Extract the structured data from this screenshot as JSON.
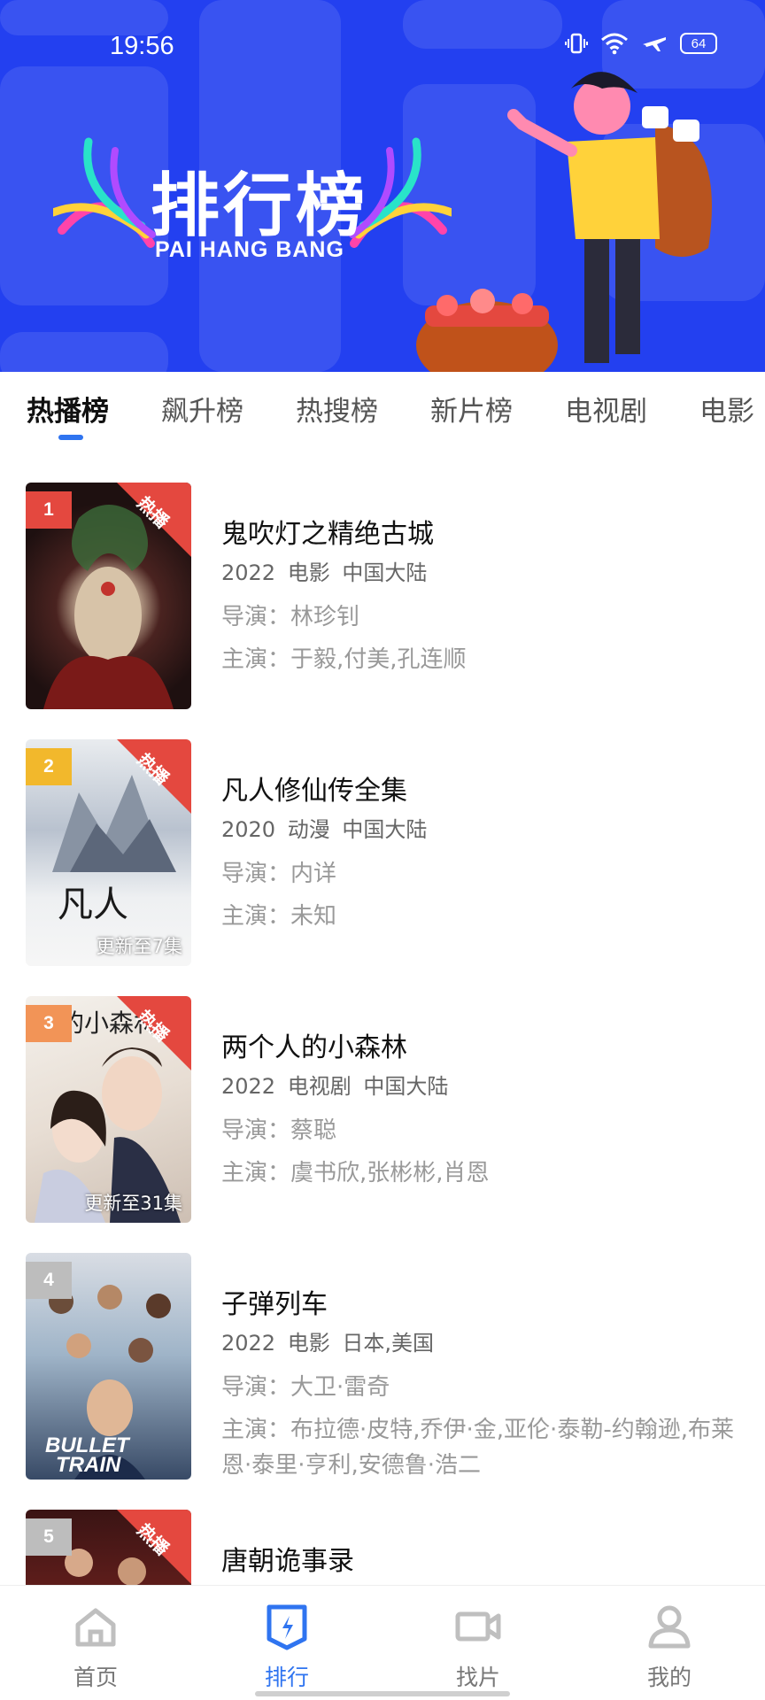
{
  "status_bar": {
    "time": "19:56",
    "battery": "64"
  },
  "banner": {
    "title": "排行榜",
    "subtitle": "PAI HANG BANG"
  },
  "tabs": [
    {
      "label": "热播榜",
      "active": true
    },
    {
      "label": "飙升榜",
      "active": false
    },
    {
      "label": "热搜榜",
      "active": false
    },
    {
      "label": "新片榜",
      "active": false
    },
    {
      "label": "电视剧",
      "active": false
    },
    {
      "label": "电影",
      "active": false
    }
  ],
  "hot_badge": "热播",
  "items": [
    {
      "rank": "1",
      "rank_color": "#e4483f",
      "hot": true,
      "update": "",
      "title": "鬼吹灯之精绝古城",
      "meta": "2022 电影 中国大陆",
      "director": "导演：林珍钊",
      "cast": "主演：于毅,付美,孔连顺"
    },
    {
      "rank": "2",
      "rank_color": "#f2b82c",
      "hot": true,
      "update": "更新至7集",
      "title": "凡人修仙传全集",
      "meta": "2020 动漫 中国大陆",
      "director": "导演：内详",
      "cast": "主演：未知"
    },
    {
      "rank": "3",
      "rank_color": "#f29457",
      "hot": true,
      "update": "更新至31集",
      "title": "两个人的小森林",
      "meta": "2022 电视剧 中国大陆",
      "director": "导演：蔡聪",
      "cast": "主演：虞书欣,张彬彬,肖恩"
    },
    {
      "rank": "4",
      "rank_color": "#bdbdbd",
      "hot": false,
      "update": "",
      "title": "子弹列车",
      "meta": "2022 电影 日本,美国",
      "director": "导演：大卫·雷奇",
      "cast": "主演：布拉德·皮特,乔伊·金,亚伦·泰勒-约翰逊,布莱恩·泰里·亨利,安德鲁·浩二"
    },
    {
      "rank": "5",
      "rank_color": "#bdbdbd",
      "hot": true,
      "update": "",
      "title": "唐朝诡事录",
      "meta": "",
      "director": "",
      "cast": ""
    }
  ],
  "bottom_nav": [
    {
      "label": "首页",
      "icon": "home-icon",
      "active": false
    },
    {
      "label": "排行",
      "icon": "ranking-icon",
      "active": true
    },
    {
      "label": "找片",
      "icon": "video-camera-icon",
      "active": false
    },
    {
      "label": "我的",
      "icon": "user-icon",
      "active": false
    }
  ],
  "colors": {
    "accent": "#2f74f0",
    "banner_bg": "#2340f0",
    "hot_badge": "#e4483f"
  }
}
